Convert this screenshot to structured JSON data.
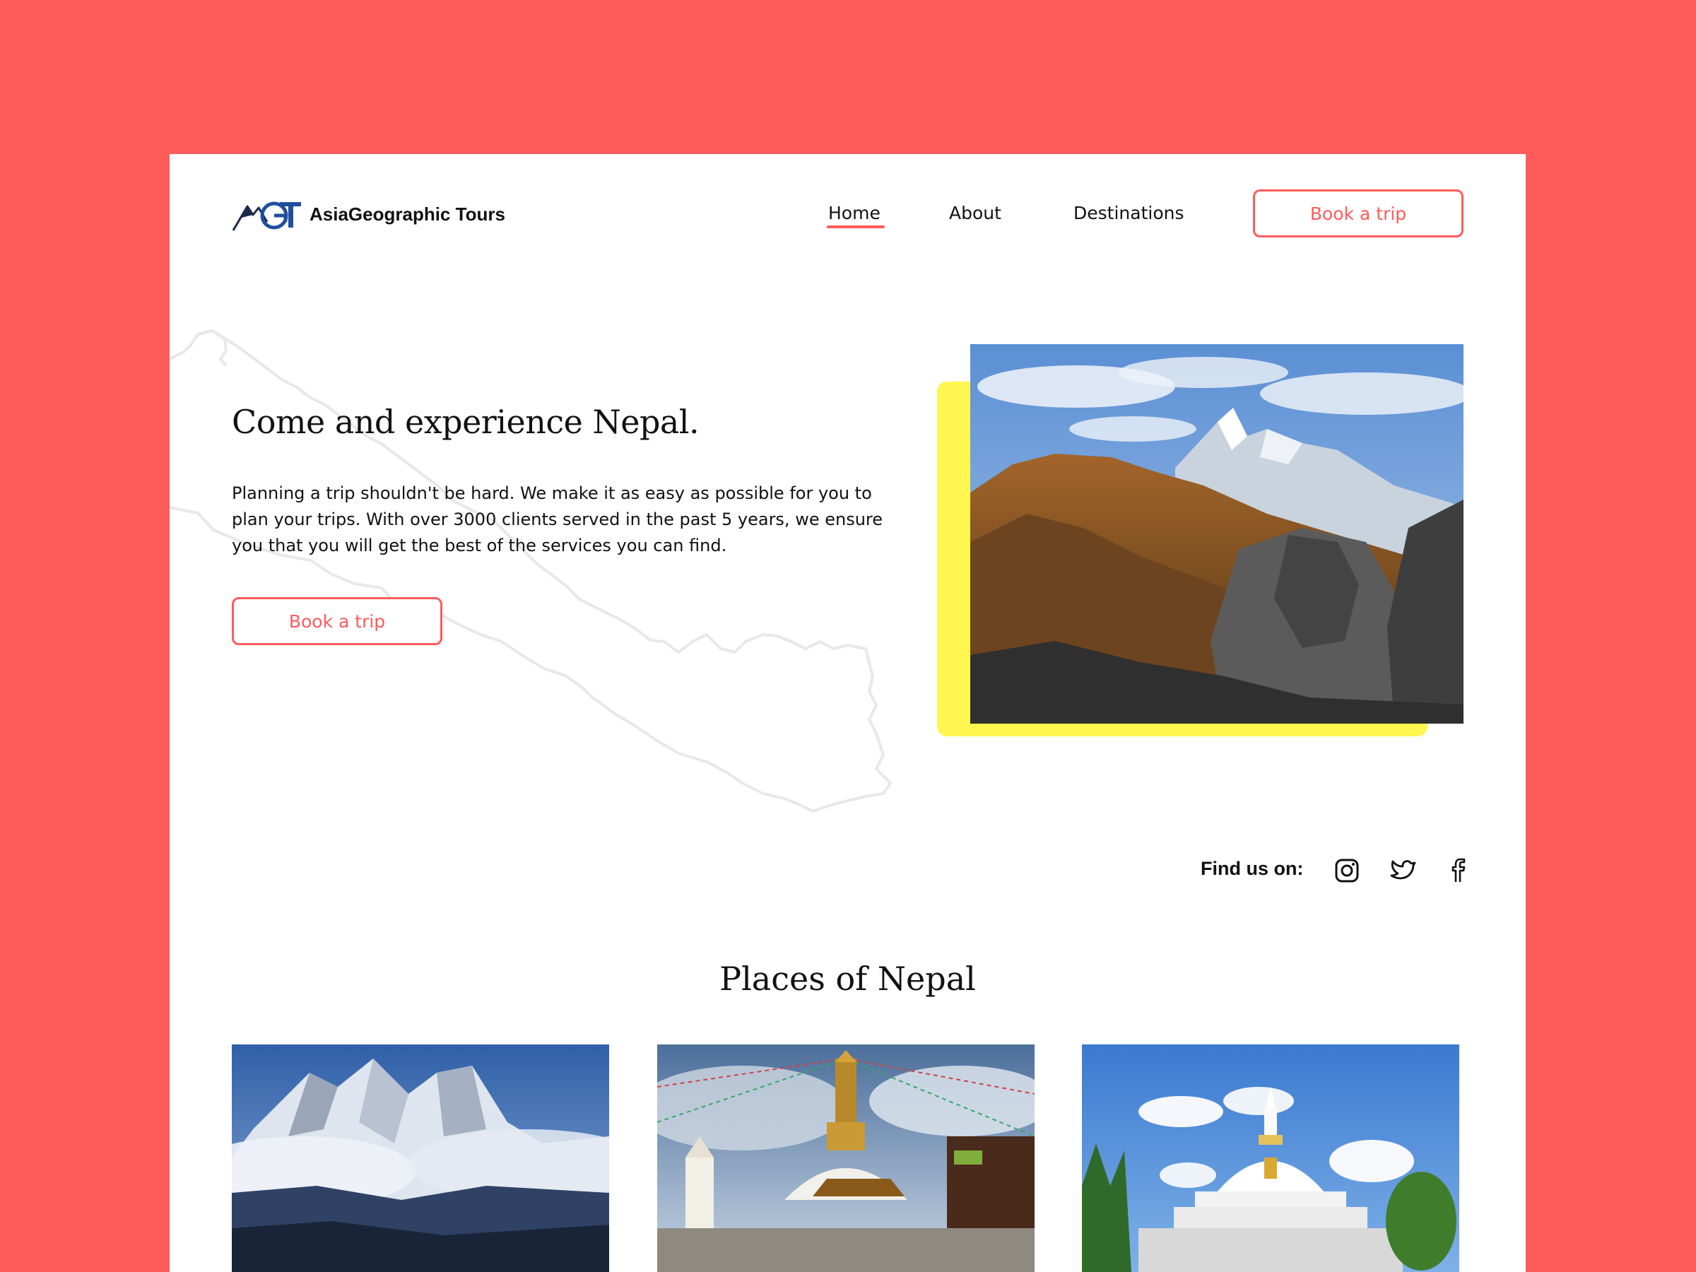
{
  "brand": {
    "name": "AsiaGeographic Tours",
    "logo_letters": "AGT"
  },
  "nav": {
    "items": [
      {
        "label": "Home",
        "active": true
      },
      {
        "label": "About",
        "active": false
      },
      {
        "label": "Destinations",
        "active": false
      }
    ],
    "cta_label": "Book a trip"
  },
  "hero": {
    "title": "Come and experience Nepal.",
    "description": "Planning a trip shouldn't be hard. We make it as easy as possible for you to plan your trips. With over 3000 clients served in the past 5 years, we ensure you that you will get the best of the services you can find.",
    "cta_label": "Book a trip",
    "photo_icon": "mountain-photo"
  },
  "social": {
    "label": "Find us on:",
    "icons": [
      "instagram-icon",
      "twitter-icon",
      "facebook-icon"
    ]
  },
  "places": {
    "title": "Places of Nepal",
    "cards": [
      {
        "photo": "snowy-peaks-photo"
      },
      {
        "photo": "swayambhunath-stupa-photo"
      },
      {
        "photo": "white-peace-pagoda-photo"
      }
    ]
  },
  "colors": {
    "background": "#fe5b5b",
    "accent": "#fe5b5b",
    "highlight": "#fff64f",
    "text": "#111111",
    "logo_blue": "#1f4e9c"
  }
}
